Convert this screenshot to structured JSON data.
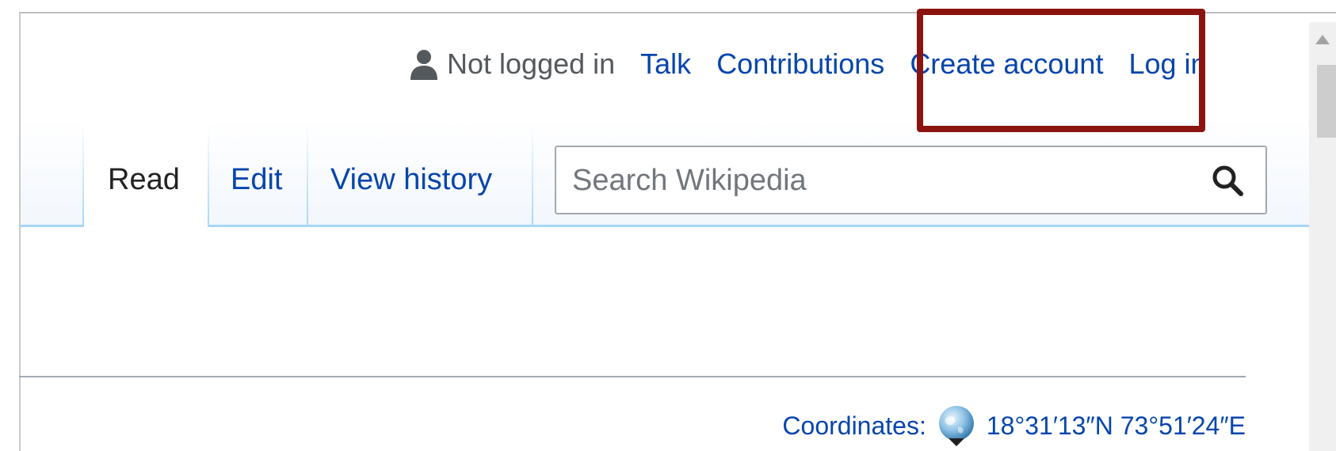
{
  "personal_tools": {
    "anon_label": "Not logged in",
    "talk": "Talk",
    "contributions": "Contributions",
    "create_account": "Create account",
    "log_in": "Log in"
  },
  "tabs": {
    "read": "Read",
    "edit": "Edit",
    "view_history": "View history"
  },
  "search": {
    "placeholder": "Search Wikipedia",
    "icon": "search-icon"
  },
  "coordinates": {
    "label": "Coordinates:",
    "value": "18°31′13″N 73°51′24″E",
    "icon": "globe-icon"
  },
  "colors": {
    "link": "#0645ad",
    "highlight_border": "#8b1410",
    "tab_border": "#a7d7f9"
  }
}
